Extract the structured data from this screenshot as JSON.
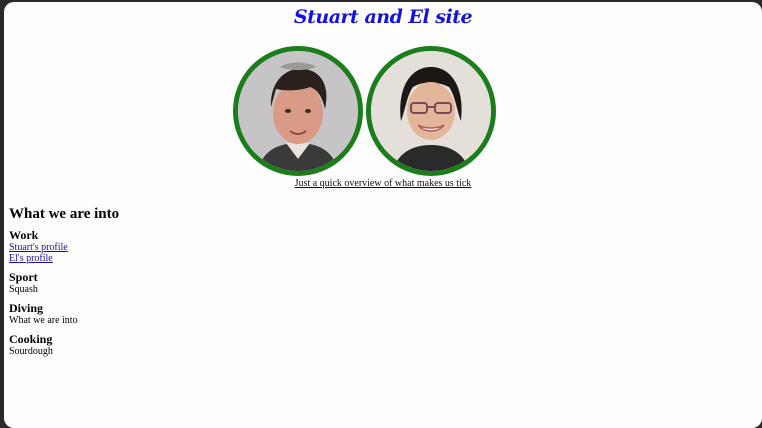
{
  "header": {
    "title": "Stuart and El site"
  },
  "photos": [
    {
      "person": "Stuart",
      "icon": "stuart-portrait",
      "border_color": "#1c7d1c"
    },
    {
      "person": "El",
      "icon": "el-portrait",
      "border_color": "#1c7d1c"
    }
  ],
  "tagline": "Just a quick overview of what makes us tick",
  "interests": {
    "heading": "What we are into",
    "work": {
      "title": "Work",
      "links": [
        "Stuart's profile",
        "El's profile"
      ]
    },
    "sport": {
      "title": "Sport",
      "text": "Squash"
    },
    "diving": {
      "title": "Diving",
      "text": "What we are into"
    },
    "cooking": {
      "title": "Cooking",
      "text": "Sourdough"
    }
  },
  "colors": {
    "title": "#1212e6",
    "photo_border": "#1c7d1c",
    "link": "#1a0dab"
  }
}
